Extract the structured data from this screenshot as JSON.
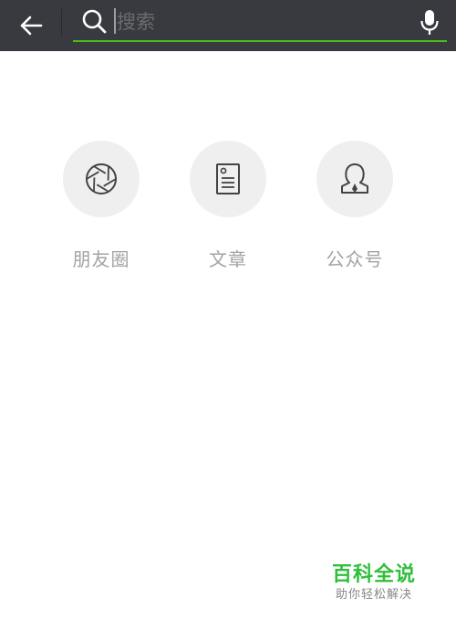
{
  "search": {
    "placeholder": "搜索",
    "value": ""
  },
  "icons": {
    "back": "arrow-left-icon",
    "search": "search-icon",
    "voice": "microphone-icon"
  },
  "categories": [
    {
      "label": "朋友圈",
      "icon": "aperture-icon"
    },
    {
      "label": "文章",
      "icon": "article-icon"
    },
    {
      "label": "公众号",
      "icon": "person-icon"
    }
  ],
  "watermark": {
    "title": "百科全说",
    "subtitle": "助你轻松解决"
  },
  "colors": {
    "topbar": "#393a3f",
    "accent": "#45c01a",
    "circle": "#efefef",
    "label": "#a3a3a3",
    "watermark": "#2fbf3a"
  }
}
